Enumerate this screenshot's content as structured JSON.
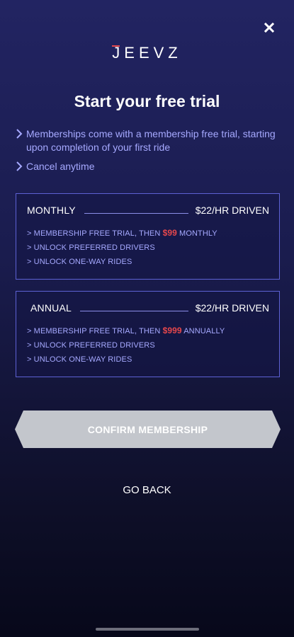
{
  "close_icon": "close-icon",
  "logo": {
    "first": "J",
    "rest": "EEVZ"
  },
  "title": "Start your free trial",
  "bullets": [
    "Memberships come with a membership free trial, starting upon completion of your first ride",
    "Cancel anytime"
  ],
  "plans": [
    {
      "name": "MONTHLY",
      "price": "$22/HR DRIVEN",
      "feature1_prefix": "> MEMBERSHIP FREE TRIAL, THEN ",
      "feature1_amount": "$99",
      "feature1_suffix": " MONTHLY",
      "feature2": "> UNLOCK PREFERRED DRIVERS",
      "feature3": "> UNLOCK ONE-WAY RIDES"
    },
    {
      "name": "ANNUAL",
      "price": "$22/HR DRIVEN",
      "feature1_prefix": "> MEMBERSHIP FREE TRIAL, THEN ",
      "feature1_amount": "$999",
      "feature1_suffix": " ANNUALLY",
      "feature2": "> UNLOCK PREFERRED DRIVERS",
      "feature3": "> UNLOCK ONE-WAY RIDES"
    }
  ],
  "confirm_label": "CONFIRM MEMBERSHIP",
  "go_back_label": "GO BACK",
  "colors": {
    "accent": "#a6a9ff",
    "price_highlight": "#e5474c",
    "border": "#5d61d4",
    "button_disabled": "#c3c6cc"
  }
}
